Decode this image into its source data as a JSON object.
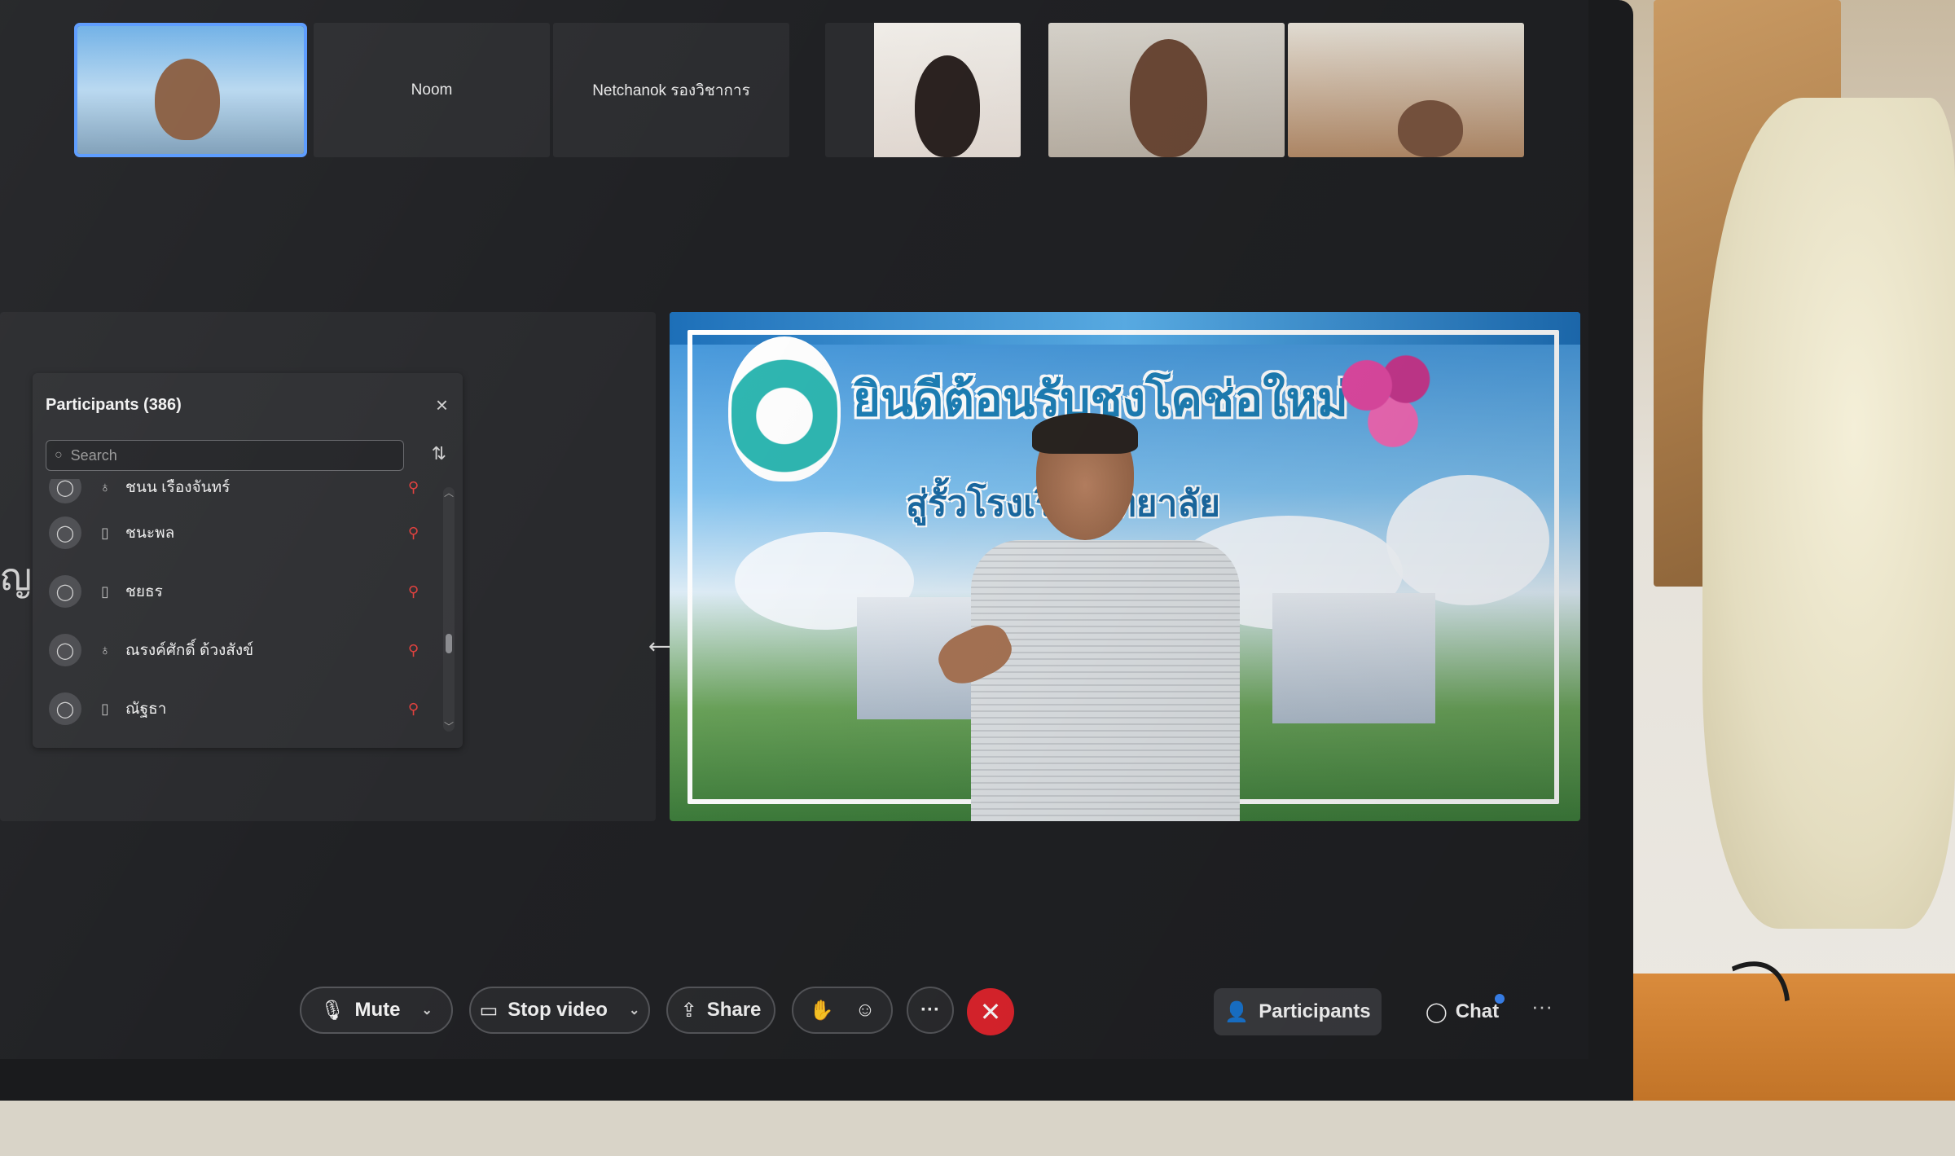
{
  "video_strip": {
    "tiles": [
      {
        "name": ""
      },
      {
        "name": "Noom"
      },
      {
        "name": "Netchanok รองวิชาการ"
      },
      {
        "name": ""
      },
      {
        "name": ""
      },
      {
        "name": ""
      }
    ]
  },
  "participants_panel": {
    "title": "Participants (386)",
    "search_placeholder": "Search",
    "rows": [
      {
        "name": "ชนน เรืองจันทร์",
        "device": "headset-icon",
        "muted": true
      },
      {
        "name": "ชนะพล",
        "device": "phone-icon",
        "muted": true
      },
      {
        "name": "ชยธร",
        "device": "phone-icon",
        "muted": true
      },
      {
        "name": "ณรงค์ศักดิ์ ด้วงสังข์",
        "device": "headset-icon",
        "muted": true
      },
      {
        "name": "ณัฐธา",
        "device": "phone-icon",
        "muted": true
      }
    ]
  },
  "main_video": {
    "banner_title": "ยินดีต้อนรับชงโคช่อใหม่",
    "banner_subtitle": "สู่รั้วโรงเรียน       ทยาลัย"
  },
  "side_text": "ญ",
  "toolbar": {
    "mute_label": "Mute",
    "stop_video_label": "Stop video",
    "share_label": "Share",
    "more_label": "···",
    "end_label": "✕",
    "participants_label": "Participants",
    "chat_label": "Chat",
    "overflow_label": "···"
  },
  "colors": {
    "accent": "#5a9bff",
    "end_call": "#e0242d",
    "muted_mic": "#e0413e",
    "notification_dot": "#3d8bff"
  }
}
